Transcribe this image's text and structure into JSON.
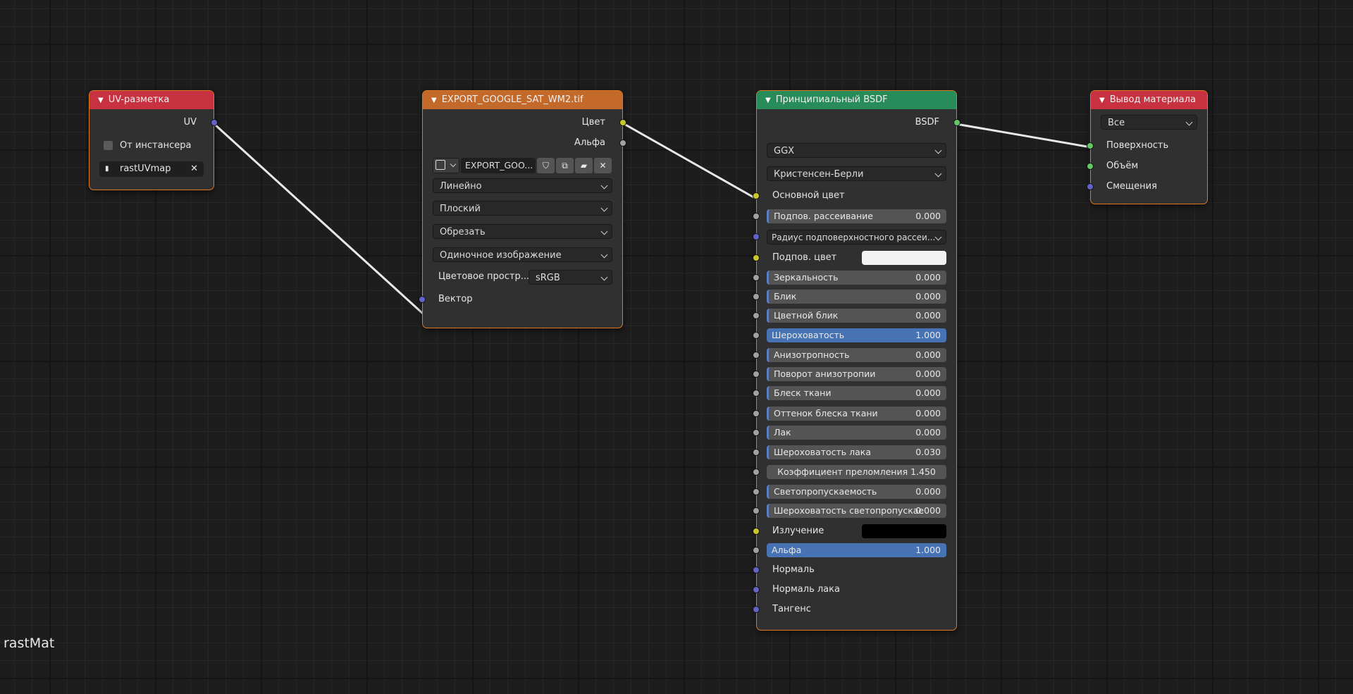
{
  "material_name": "rastMat",
  "colors": {
    "uv_header": "#c83240",
    "texture_header": "#c3692a",
    "shader_header": "#288c5a",
    "output_header": "#c83240",
    "node_border": "#e07a22",
    "link": "#e8e8e8",
    "socket_vector": "#6363c7",
    "socket_color": "#c7c729",
    "socket_float": "#a1a1a1",
    "socket_shader": "#63c763"
  },
  "uv_node": {
    "title": "UV-разметка",
    "output_uv": "UV",
    "from_instancer": "От инстансера",
    "uvmap": "rastUVmap"
  },
  "image_node": {
    "title": "EXPORT_GOOGLE_SAT_WM2.tif",
    "out_color": "Цвет",
    "out_alpha": "Альфа",
    "image_name": "EXPORT_GOO...",
    "interpolation": "Линейно",
    "projection": "Плоский",
    "extension": "Обрезать",
    "source": "Одиночное изображение",
    "colorspace_label": "Цветовое простр...",
    "colorspace_value": "sRGB",
    "in_vector": "Вектор"
  },
  "bsdf_node": {
    "title": "Принципиальный BSDF",
    "out_bsdf": "BSDF",
    "distribution": "GGX",
    "subsurface_method": "Кристенсен-Берли",
    "base_color": "Основной цвет",
    "subsurface": {
      "label": "Подпов. рассеивание",
      "value": "0.000"
    },
    "subsurface_radius": "Радиус подповерхностного рассеи...",
    "subsurface_color": "Подпов. цвет",
    "metallic": {
      "label": "Зеркальность",
      "value": "0.000"
    },
    "specular": {
      "label": "Блик",
      "value": "0.000"
    },
    "specular_tint": {
      "label": "Цветной блик",
      "value": "0.000"
    },
    "roughness": {
      "label": "Шероховатость",
      "value": "1.000"
    },
    "anisotropic": {
      "label": "Анизотропность",
      "value": "0.000"
    },
    "anisotropic_rotation": {
      "label": "Поворот анизотропии",
      "value": "0.000"
    },
    "sheen": {
      "label": "Блеск ткани",
      "value": "0.000"
    },
    "sheen_tint": {
      "label": "Оттенок блеска ткани",
      "value": "0.000"
    },
    "clearcoat": {
      "label": "Лак",
      "value": "0.000"
    },
    "clearcoat_roughness": {
      "label": "Шероховатость лака",
      "value": "0.030"
    },
    "ior": {
      "label": "Коэффициент преломления",
      "value": "1.450"
    },
    "transmission": {
      "label": "Светопропускаемость",
      "value": "0.000"
    },
    "transmission_roughness": {
      "label": "Шероховатость светопропускае",
      "value": "0.000"
    },
    "emission": "Излучение",
    "alpha": {
      "label": "Альфа",
      "value": "1.000"
    },
    "normal": "Нормаль",
    "clearcoat_normal": "Нормаль лака",
    "tangent": "Тангенс"
  },
  "output_node": {
    "title": "Вывод материала",
    "target": "Все",
    "surface": "Поверхность",
    "volume": "Объём",
    "displacement": "Смещения"
  }
}
